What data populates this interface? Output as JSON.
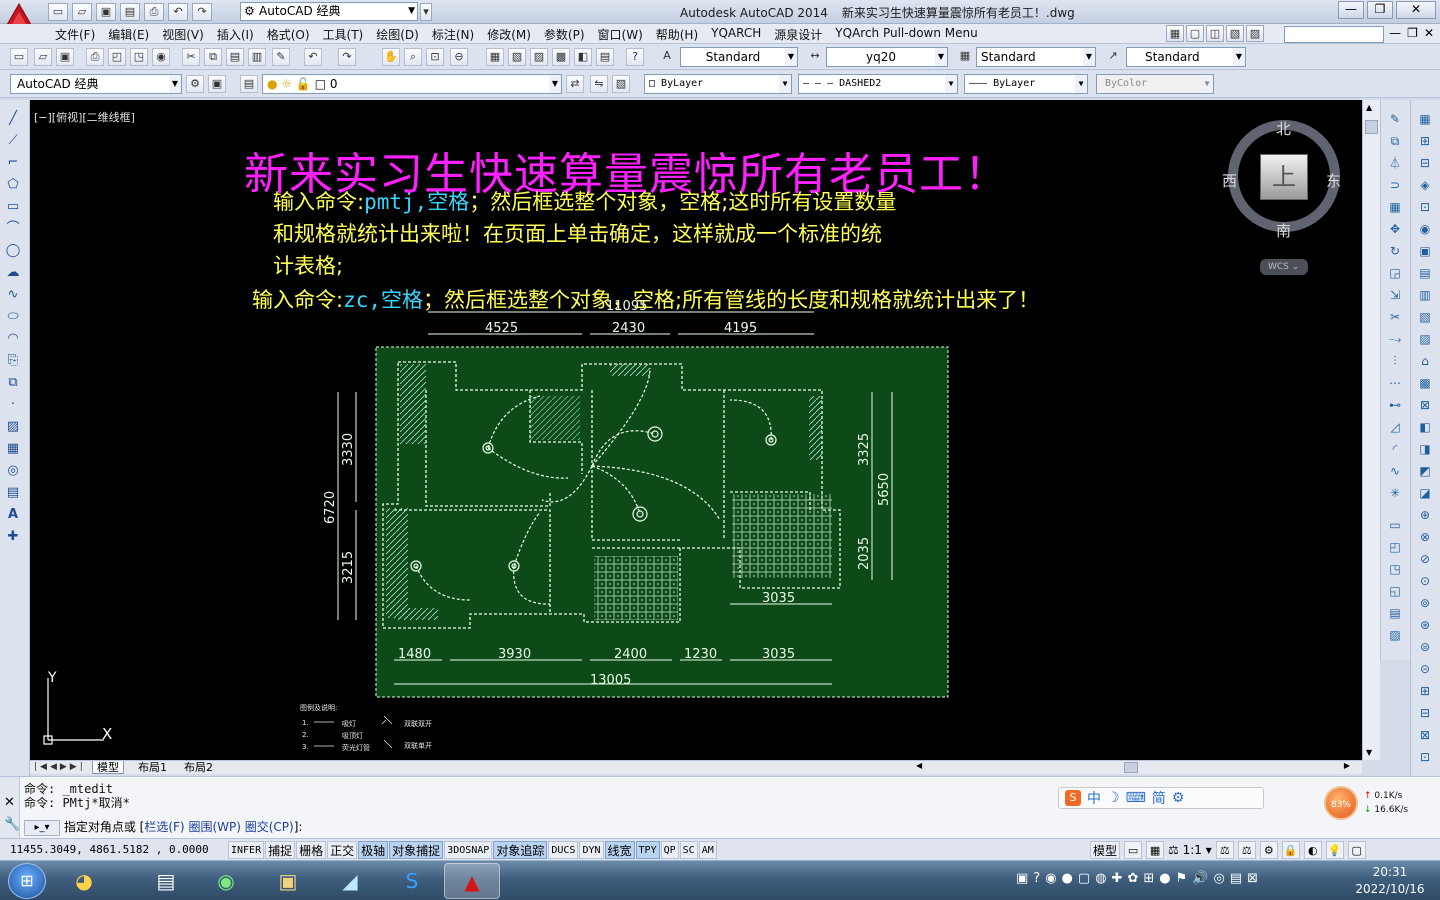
{
  "window": {
    "app_name": "Autodesk AutoCAD 2014",
    "file_title": "新来实习生快速算量震惊所有老员工！.dwg",
    "workspace": "AutoCAD 经典",
    "controls": [
      "—",
      "❐",
      "✕"
    ]
  },
  "menubar": {
    "items": [
      "文件(F)",
      "编辑(E)",
      "视图(V)",
      "插入(I)",
      "格式(O)",
      "工具(T)",
      "绘图(D)",
      "标注(N)",
      "修改(M)",
      "参数(P)",
      "窗口(W)",
      "帮助(H)",
      "YQARCH",
      "源泉设计",
      "YQArch Pull-down Menu"
    ]
  },
  "toolbar1": {
    "text_style": "Standard",
    "dim_style": "yq20",
    "table_style": "Standard",
    "mleader_style": "Standard"
  },
  "toolbar2": {
    "workspace": "AutoCAD 经典",
    "layer": "0",
    "color": "ByLayer",
    "linetype": "DASHED2",
    "lineweight": "ByLayer",
    "plotstyle": "ByColor"
  },
  "canvas": {
    "view_label": "[−][俯视][二维线框]",
    "title": "新来实习生快速算量震惊所有老员工！",
    "instr1_a": "输入命令:",
    "instr1_cmd": "pmtj,空格",
    "instr1_b": "；然后框选整个对象，空格;这时所有设置数量",
    "instr2": "和规格就统计出来啦！在页面上单击确定，这样就成一个标准的统",
    "instr3": "计表格;",
    "instr4_a": "输入命令:",
    "instr4_cmd": "zc,空格",
    "instr4_b": "；然后框选整个对象，空格;所有管线的长度和规格就统计出来了！",
    "compass": {
      "n": "北",
      "s": "南",
      "e": "东",
      "w": "西",
      "face": "上"
    },
    "wcs": "WCS",
    "ucs_x": "X",
    "ucs_y": "Y",
    "dims": {
      "top_total": "11095",
      "top_a": "4525",
      "top_b": "2430",
      "top_c": "4195",
      "left_total": "6720",
      "left_a": "3330",
      "left_b": "3215",
      "right_total": "5650",
      "right_a": "3325",
      "right_b": "2035",
      "mid_right": "3035",
      "bot_a": "1480",
      "bot_b": "3930",
      "bot_c": "2400",
      "bot_d": "1230",
      "bot_e": "3035",
      "bot_total": "13005"
    },
    "legend": {
      "title": "图例及说明:",
      "r1": "1.",
      "r1_text": "吸灯",
      "r2": "2.",
      "r2_text": "吸顶灯",
      "r3": "3.",
      "r3_text": "荧光灯管",
      "s1": "双联双开",
      "s2": "双联单开"
    }
  },
  "tabs": {
    "items": [
      "模型",
      "布局1",
      "布局2"
    ]
  },
  "command": {
    "line1": "命令: _mtedit",
    "line2": "命令: PMtj*取消*",
    "prompt": "指定对角点或 [",
    "opt1": "栏选(F)",
    "opt2": "圈围(WP)",
    "opt3": "圈交(CP)",
    "end": "]:"
  },
  "ime": {
    "items": [
      "中",
      "☽",
      "⌨",
      "简"
    ]
  },
  "network": {
    "percent": "83%",
    "up": "0.1K/s",
    "down": "16.6K/s"
  },
  "statusbar": {
    "coords": "11455.3049, 4861.5182 , 0.0000",
    "buttons": [
      {
        "label": "INFER",
        "on": false
      },
      {
        "label": "捕捉",
        "on": false
      },
      {
        "label": "栅格",
        "on": false
      },
      {
        "label": "正交",
        "on": false
      },
      {
        "label": "极轴",
        "on": true
      },
      {
        "label": "对象捕捉",
        "on": true
      },
      {
        "label": "3DOSNAP",
        "on": false
      },
      {
        "label": "对象追踪",
        "on": true
      },
      {
        "label": "DUCS",
        "on": false
      },
      {
        "label": "DYN",
        "on": false
      },
      {
        "label": "线宽",
        "on": true
      },
      {
        "label": "TPY",
        "on": true
      },
      {
        "label": "QP",
        "on": false
      },
      {
        "label": "SC",
        "on": false
      },
      {
        "label": "AM",
        "on": false
      }
    ],
    "model": "模型",
    "scale": "1:1"
  },
  "taskbar": {
    "time": "20:31",
    "date": "2022/10/16"
  }
}
